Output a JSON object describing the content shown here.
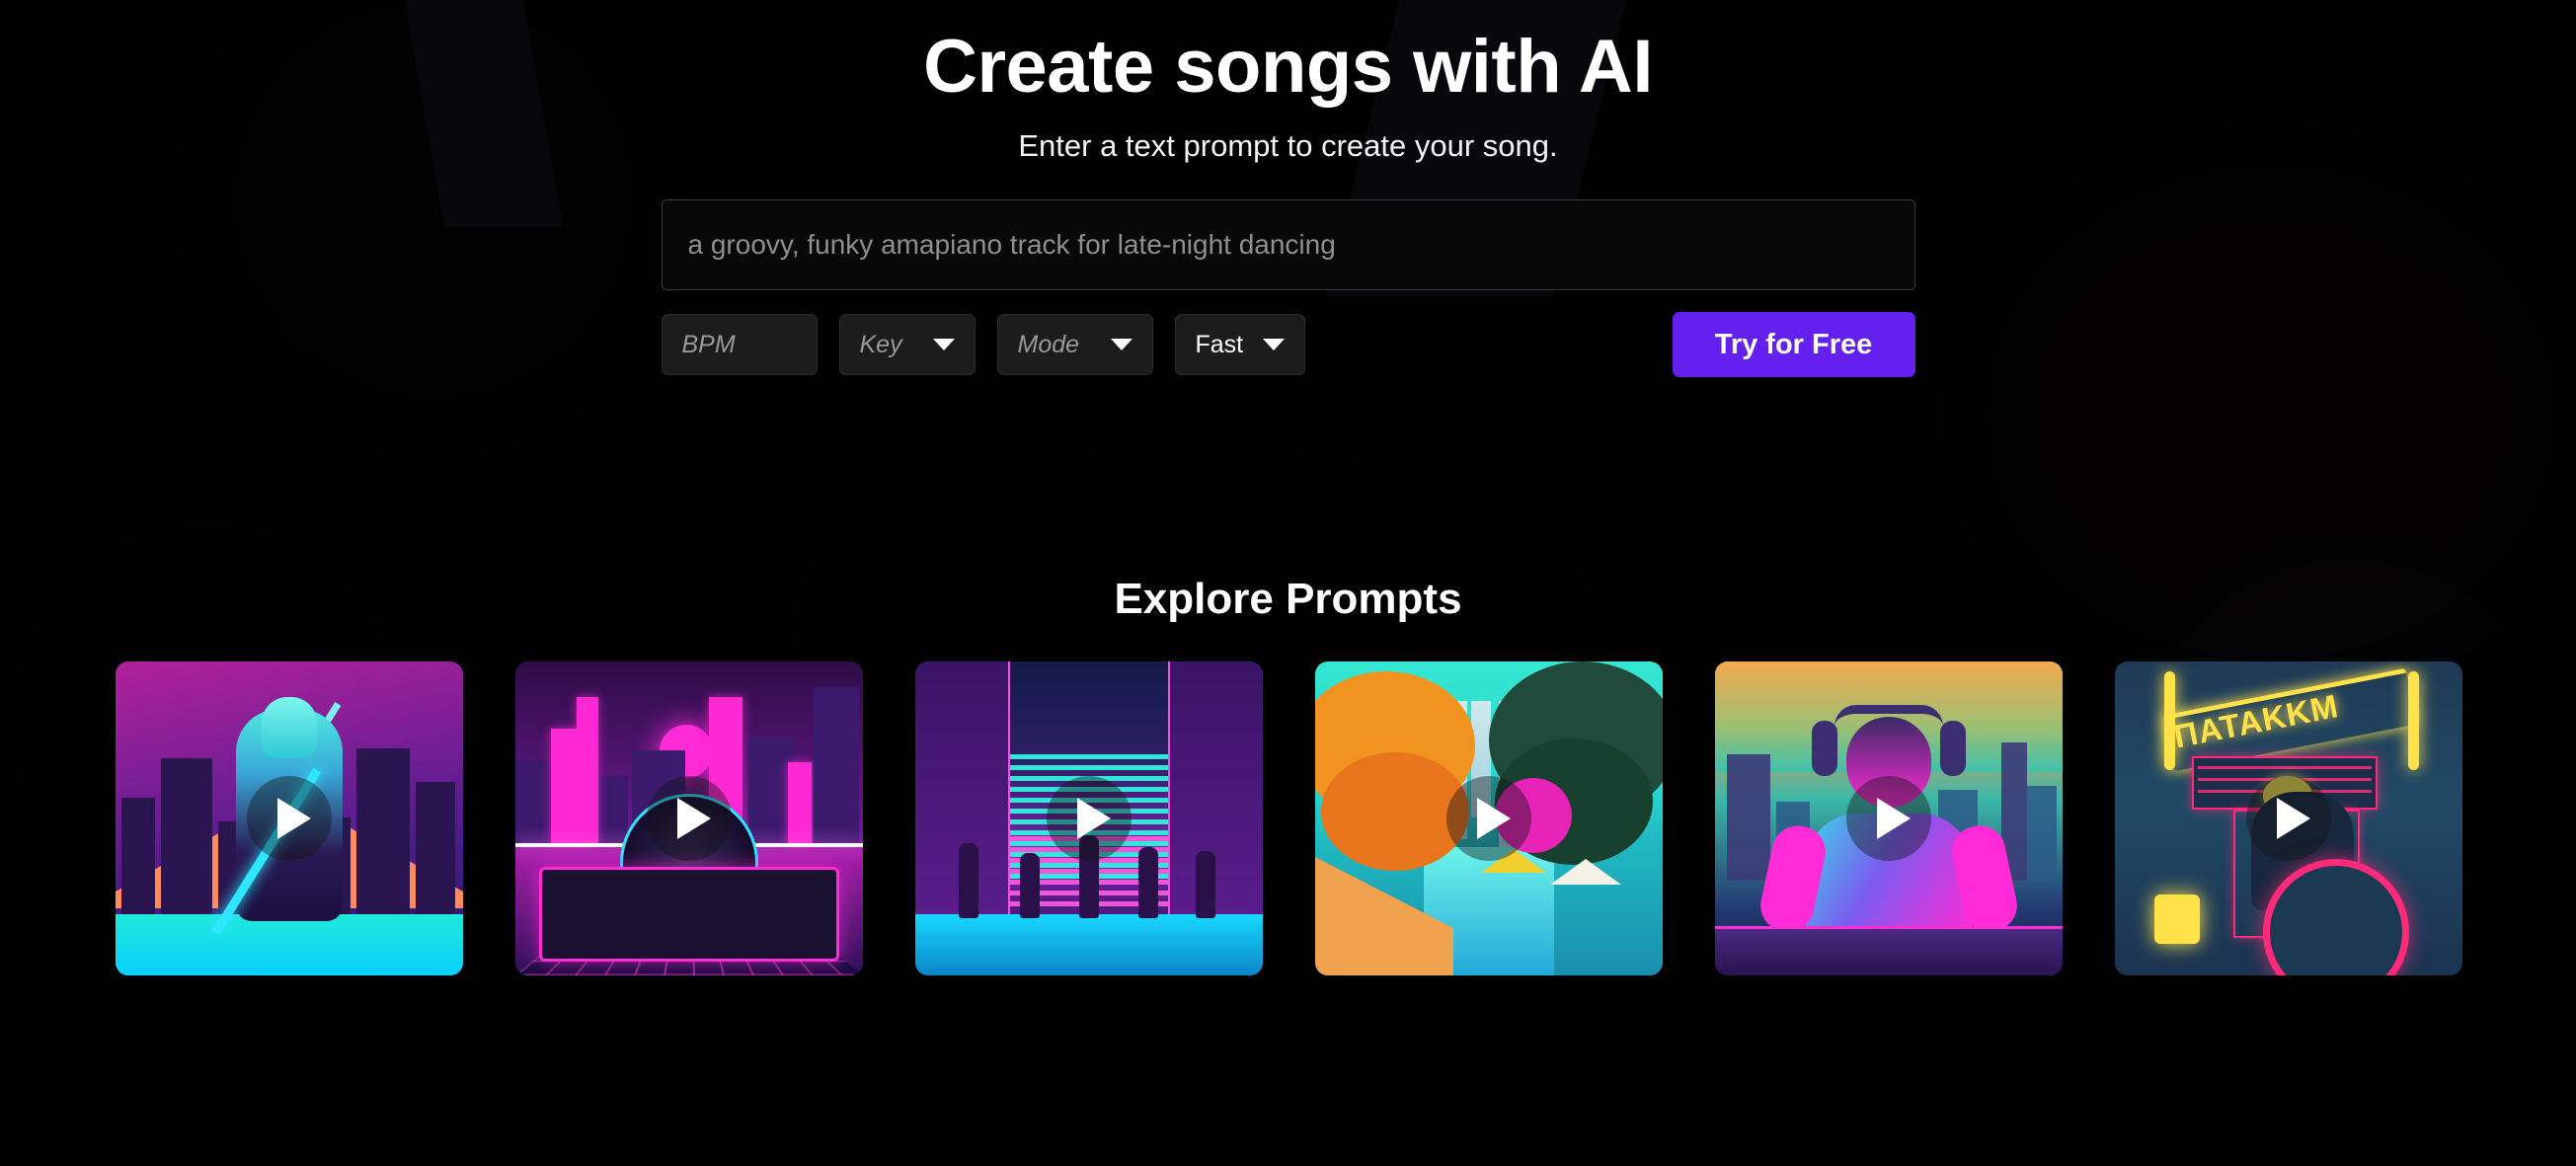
{
  "hero": {
    "title": "Create songs with AI",
    "subtitle": "Enter a text prompt to create your song."
  },
  "form": {
    "prompt_input": {
      "value": "",
      "placeholder": "a groovy, funky amapiano track for late-night dancing"
    },
    "bpm_input": {
      "value": "",
      "placeholder": "BPM"
    },
    "key_select": {
      "selected": "",
      "placeholder": "Key"
    },
    "mode_select": {
      "selected": "",
      "placeholder": "Mode"
    },
    "speed_select": {
      "selected": "Fast"
    },
    "cta_label": "Try for Free"
  },
  "explore": {
    "heading": "Explore Prompts",
    "cards": [
      {
        "name": "neon-cyber-knight",
        "play_label": "play"
      },
      {
        "name": "synthwave-turntable",
        "play_label": "play"
      },
      {
        "name": "neon-street-dancers",
        "play_label": "play"
      },
      {
        "name": "tropical-neon-canal",
        "play_label": "play"
      },
      {
        "name": "sunset-dj-skyline",
        "play_label": "play"
      },
      {
        "name": "neon-sign-drums",
        "play_label": "play",
        "sign_text": "ΠATAKKΜ"
      }
    ]
  },
  "colors": {
    "background": "#000000",
    "accent_purple": "#6320EE",
    "text_primary": "#FFFFFF",
    "text_muted": "#8F8F8F",
    "field_background": "#1C1C1C",
    "field_border": "#2D2D2D"
  }
}
